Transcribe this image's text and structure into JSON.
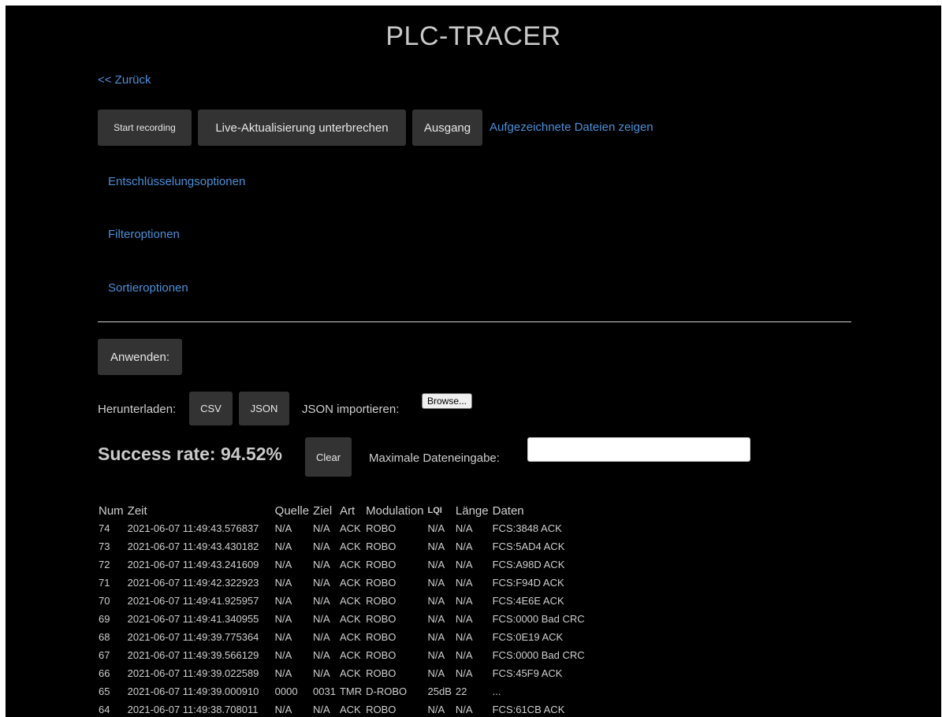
{
  "header": {
    "title": "PLC-TRACER",
    "back_link": "<< Zurück"
  },
  "toolbar": {
    "start_recording": "Start recording",
    "pause_live": "Live-Aktualisierung unterbrechen",
    "exit": "Ausgang",
    "show_recorded": "Aufgezeichnete Dateien zeigen"
  },
  "options": {
    "decryption": "Entschlüsselungsoptionen",
    "filter": "Filteroptionen",
    "sort": "Sortieroptionen"
  },
  "apply": {
    "label": "Anwenden:"
  },
  "download": {
    "label": "Herunterladen:",
    "csv": "CSV",
    "json": "JSON",
    "import_label": "JSON importieren:",
    "browse": "Browse..."
  },
  "stats": {
    "success_rate": "Success rate: 94.52%",
    "clear": "Clear",
    "max_input_label": "Maximale Dateneingabe:",
    "max_input_value": ""
  },
  "table": {
    "columns": [
      "Num",
      "Zeit",
      "Quelle",
      "Ziel",
      "Art",
      "Modulation",
      "LQI",
      "Länge",
      "Daten"
    ],
    "rows": [
      [
        "74",
        "2021-06-07 11:49:43.576837",
        "N/A",
        "N/A",
        "ACK",
        "ROBO",
        "N/A",
        "N/A",
        "FCS:3848 ACK"
      ],
      [
        "73",
        "2021-06-07 11:49:43.430182",
        "N/A",
        "N/A",
        "ACK",
        "ROBO",
        "N/A",
        "N/A",
        "FCS:5AD4 ACK"
      ],
      [
        "72",
        "2021-06-07 11:49:43.241609",
        "N/A",
        "N/A",
        "ACK",
        "ROBO",
        "N/A",
        "N/A",
        "FCS:A98D ACK"
      ],
      [
        "71",
        "2021-06-07 11:49:42.322923",
        "N/A",
        "N/A",
        "ACK",
        "ROBO",
        "N/A",
        "N/A",
        "FCS:F94D ACK"
      ],
      [
        "70",
        "2021-06-07 11:49:41.925957",
        "N/A",
        "N/A",
        "ACK",
        "ROBO",
        "N/A",
        "N/A",
        "FCS:4E6E ACK"
      ],
      [
        "69",
        "2021-06-07 11:49:41.340955",
        "N/A",
        "N/A",
        "ACK",
        "ROBO",
        "N/A",
        "N/A",
        "FCS:0000 Bad CRC"
      ],
      [
        "68",
        "2021-06-07 11:49:39.775364",
        "N/A",
        "N/A",
        "ACK",
        "ROBO",
        "N/A",
        "N/A",
        "FCS:0E19 ACK"
      ],
      [
        "67",
        "2021-06-07 11:49:39.566129",
        "N/A",
        "N/A",
        "ACK",
        "ROBO",
        "N/A",
        "N/A",
        "FCS:0000 Bad CRC"
      ],
      [
        "66",
        "2021-06-07 11:49:39.022589",
        "N/A",
        "N/A",
        "ACK",
        "ROBO",
        "N/A",
        "N/A",
        "FCS:45F9 ACK"
      ],
      [
        "65",
        "2021-06-07 11:49:39.000910",
        "0000",
        "0031",
        "TMR",
        "D-ROBO",
        "25dB",
        "22",
        "..."
      ],
      [
        "64",
        "2021-06-07 11:49:38.708011",
        "N/A",
        "N/A",
        "ACK",
        "ROBO",
        "N/A",
        "N/A",
        "FCS:61CB ACK"
      ]
    ]
  }
}
